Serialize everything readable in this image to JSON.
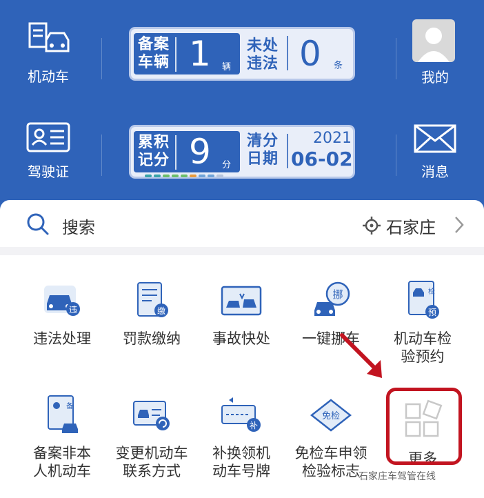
{
  "header": {
    "vehicle_label": "机动车",
    "license_label": "驾驶证",
    "mine_label": "我的",
    "message_label": "消息",
    "panel1": {
      "left_title_1": "备案",
      "left_title_2": "车辆",
      "left_value": "1",
      "left_unit": "辆",
      "right_title_1": "未处",
      "right_title_2": "违法",
      "right_value": "0",
      "right_unit": "条"
    },
    "panel2": {
      "left_title_1": "累积",
      "left_title_2": "记分",
      "left_value": "9",
      "left_unit": "分",
      "right_title_1": "清分",
      "right_title_2": "日期",
      "year": "2021",
      "date": "06-02"
    },
    "brand_color": "#2f63b9"
  },
  "search": {
    "placeholder": "搜索",
    "city": "石家庄"
  },
  "services": [
    {
      "label": "违法处理",
      "icon": "violation-icon"
    },
    {
      "label": "罚款缴纳",
      "icon": "fine-payment-icon"
    },
    {
      "label": "事故快处",
      "icon": "accident-icon"
    },
    {
      "label": "一键挪车",
      "icon": "move-car-icon"
    },
    {
      "label_1": "机动车检",
      "label_2": "验预约",
      "icon": "inspection-booking-icon"
    },
    {
      "label_1": "备案非本",
      "label_2": "人机动车",
      "icon": "register-vehicle-icon"
    },
    {
      "label_1": "变更机动车",
      "label_2": "联系方式",
      "icon": "change-contact-icon"
    },
    {
      "label_1": "补换领机",
      "label_2": "动车号牌",
      "icon": "plate-replace-icon"
    },
    {
      "label_1": "免检车申领",
      "label_2": "检验标志",
      "icon": "exempt-sticker-icon"
    },
    {
      "label": "更多",
      "icon": "more-icon"
    }
  ],
  "annotation_color": "#c21420",
  "watermark": "石家庄车驾管在线"
}
